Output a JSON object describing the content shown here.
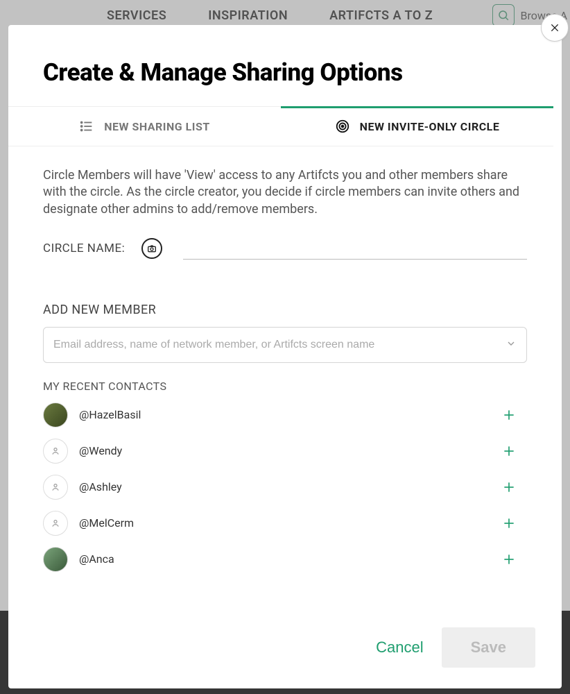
{
  "nav": {
    "items": [
      "SERVICES",
      "INSPIRATION",
      "ARTIFCTS A TO Z"
    ],
    "browse": "Browse A"
  },
  "modal": {
    "title": "Create & Manage Sharing Options",
    "tabs": {
      "list": "NEW SHARING LIST",
      "circle": "NEW INVITE-ONLY CIRCLE"
    },
    "description": "Circle Members will have 'View' access to any Artifcts you and other members share with the circle. As the circle creator, you decide if circle members can invite others and designate other admins to add/remove members.",
    "circle_name_label": "CIRCLE NAME:",
    "circle_name_value": "",
    "add_member_label": "ADD NEW MEMBER",
    "add_member_placeholder": "Email address, name of network member, or Artifcts screen name",
    "recent_label": "MY RECENT CONTACTS",
    "contacts": [
      {
        "handle": "@HazelBasil",
        "avatar": "img1"
      },
      {
        "handle": "@Wendy",
        "avatar": "ph"
      },
      {
        "handle": "@Ashley",
        "avatar": "ph"
      },
      {
        "handle": "@MelCerm",
        "avatar": "ph"
      },
      {
        "handle": "@Anca",
        "avatar": "img2"
      }
    ],
    "cancel": "Cancel",
    "save": "Save"
  }
}
